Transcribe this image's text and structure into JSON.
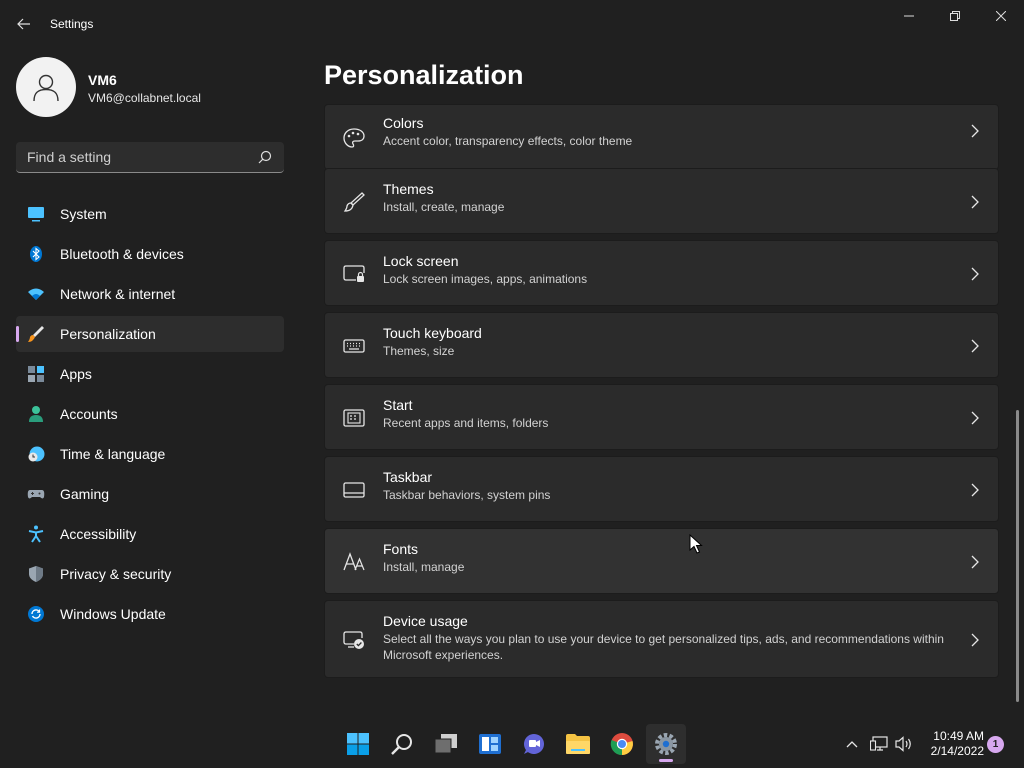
{
  "window": {
    "title": "Settings",
    "controls": [
      "minimize",
      "maximize",
      "close"
    ]
  },
  "user": {
    "name": "VM6",
    "email": "VM6@collabnet.local"
  },
  "search": {
    "placeholder": "Find a setting",
    "value": ""
  },
  "nav": {
    "items": [
      {
        "label": "System",
        "icon": "system-icon",
        "selected": false
      },
      {
        "label": "Bluetooth & devices",
        "icon": "bluetooth-icon",
        "selected": false
      },
      {
        "label": "Network & internet",
        "icon": "wifi-icon",
        "selected": false
      },
      {
        "label": "Personalization",
        "icon": "brush-icon",
        "selected": true
      },
      {
        "label": "Apps",
        "icon": "apps-icon",
        "selected": false
      },
      {
        "label": "Accounts",
        "icon": "accounts-icon",
        "selected": false
      },
      {
        "label": "Time & language",
        "icon": "clock-globe-icon",
        "selected": false
      },
      {
        "label": "Gaming",
        "icon": "gamepad-icon",
        "selected": false
      },
      {
        "label": "Accessibility",
        "icon": "accessibility-icon",
        "selected": false
      },
      {
        "label": "Privacy & security",
        "icon": "shield-icon",
        "selected": false
      },
      {
        "label": "Windows Update",
        "icon": "update-icon",
        "selected": false
      }
    ]
  },
  "page": {
    "title": "Personalization",
    "cards": [
      {
        "title": "Colors",
        "desc": "Accent color, transparency effects, color theme",
        "icon": "palette-icon"
      },
      {
        "title": "Themes",
        "desc": "Install, create, manage",
        "icon": "brush-icon"
      },
      {
        "title": "Lock screen",
        "desc": "Lock screen images, apps, animations",
        "icon": "lock-screen-icon"
      },
      {
        "title": "Touch keyboard",
        "desc": "Themes, size",
        "icon": "keyboard-icon"
      },
      {
        "title": "Start",
        "desc": "Recent apps and items, folders",
        "icon": "start-icon"
      },
      {
        "title": "Taskbar",
        "desc": "Taskbar behaviors, system pins",
        "icon": "taskbar-icon"
      },
      {
        "title": "Fonts",
        "desc": "Install, manage",
        "icon": "fonts-icon"
      },
      {
        "title": "Device usage",
        "desc": "Select all the ways you plan to use your device to get personalized tips, ads, and recommendations within Microsoft experiences.",
        "icon": "device-usage-icon"
      }
    ]
  },
  "taskbar": {
    "apps": [
      "windows-start-icon",
      "search-icon",
      "task-view-icon",
      "widgets-icon",
      "teams-chat-icon",
      "file-explorer-icon",
      "chrome-icon",
      "settings-icon"
    ],
    "active_app": "settings-icon",
    "tray": [
      "chevron-up-icon",
      "network-icon",
      "volume-icon"
    ],
    "time": "10:49 AM",
    "date": "2/14/2022",
    "notifications": "1"
  },
  "colors": {
    "background": "#202020",
    "card": "#2b2b2b",
    "accent": "#d7a8ef"
  }
}
